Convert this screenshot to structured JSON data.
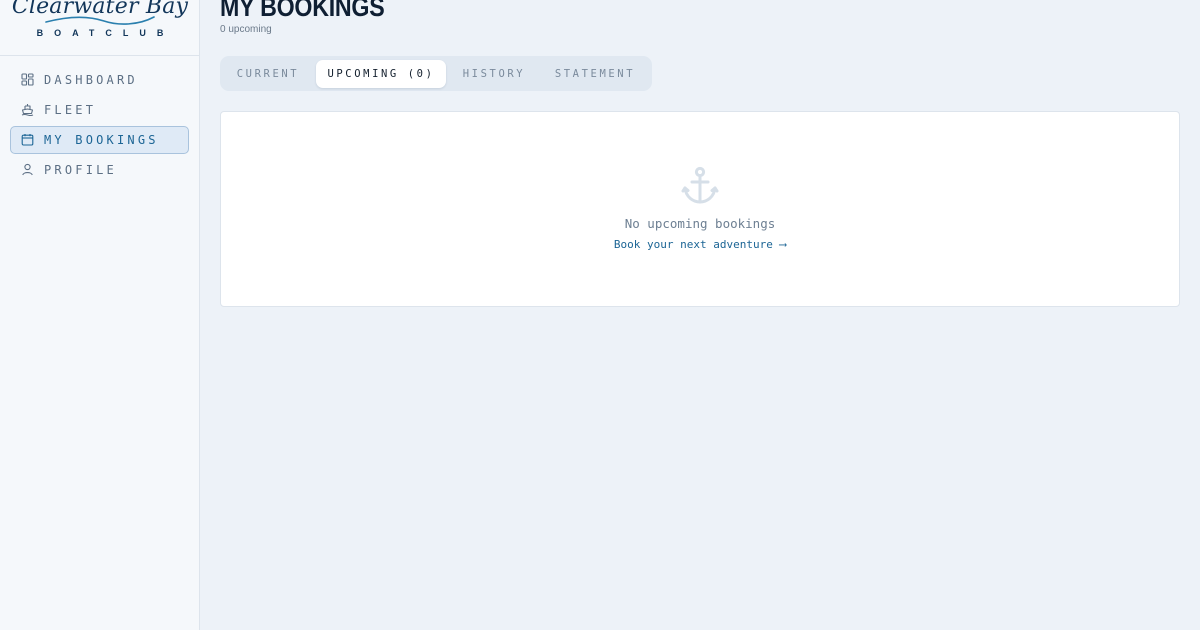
{
  "brand": {
    "name": "Clearwater Bay",
    "subtitle": "BOATCLUB"
  },
  "sidebar": {
    "items": [
      {
        "label": "DASHBOARD",
        "icon": "dashboard-grid-icon",
        "active": false
      },
      {
        "label": "FLEET",
        "icon": "boat-icon",
        "active": false
      },
      {
        "label": "MY BOOKINGS",
        "icon": "calendar-icon",
        "active": true
      },
      {
        "label": "PROFILE",
        "icon": "user-icon",
        "active": false
      }
    ]
  },
  "header": {
    "title": "MY BOOKINGS",
    "subtitle": "0 upcoming"
  },
  "tabs": [
    {
      "label": "CURRENT",
      "active": false
    },
    {
      "label": "UPCOMING (0)",
      "active": true
    },
    {
      "label": "HISTORY",
      "active": false
    },
    {
      "label": "STATEMENT",
      "active": false
    }
  ],
  "empty_state": {
    "icon": "anchor-icon",
    "message": "No upcoming bookings",
    "link": "Book your next adventure ⟶"
  },
  "colors": {
    "accent": "#1c6595",
    "brand_navy": "#12365a",
    "background": "#edf2f8"
  }
}
